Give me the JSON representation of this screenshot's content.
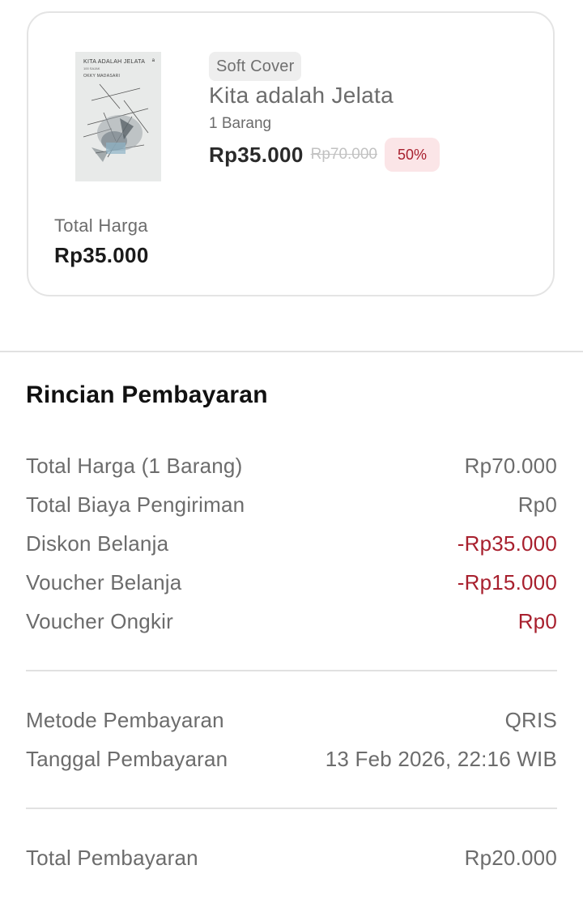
{
  "product": {
    "cover": {
      "title": "KITA ADALAH JELATA",
      "subtitle": "100 SAJAK",
      "author": "OKKY MADASARI",
      "mark": "a"
    },
    "badge": "Soft Cover",
    "title": "Kita adalah Jelata",
    "quantity": "1 Barang",
    "price": "Rp35.000",
    "old_price": "Rp70.000",
    "discount": "50%",
    "total_label": "Total Harga",
    "total_value": "Rp35.000"
  },
  "payment": {
    "title": "Rincian Pembayaran",
    "items": [
      {
        "label": "Total Harga (1 Barang)",
        "value": "Rp70.000"
      },
      {
        "label": "Total Biaya Pengiriman",
        "value": "Rp0"
      },
      {
        "label": "Diskon Belanja",
        "value": "-Rp35.000"
      },
      {
        "label": "Voucher Belanja",
        "value": "-Rp15.000"
      },
      {
        "label": "Voucher Ongkir",
        "value": "Rp0"
      }
    ],
    "method_label": "Metode Pembayaran",
    "method_value": "QRIS",
    "date_label": "Tanggal Pembayaran",
    "date_value": "13 Feb 2026, 22:16 WIB",
    "total_label": "Total Pembayaran",
    "total_value": "Rp20.000"
  },
  "colors": {
    "discount_red": "#a8202e",
    "discount_bg": "#fbe5e7",
    "muted_text": "#6c6c6c"
  }
}
